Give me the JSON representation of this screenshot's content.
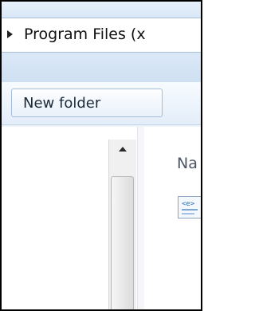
{
  "address_bar": {
    "expand_icon": "triangle-right-icon",
    "path_text": "Program Files (x"
  },
  "toolbar": {
    "new_folder_label": "New folder"
  },
  "navigation_pane": {
    "scroll_up_icon": "triangle-up-icon"
  },
  "content_pane": {
    "column_header": "Na",
    "file_icon": "html-file-icon",
    "file_icon_glyph": "<e>"
  },
  "colors": {
    "frame_blue": "#d9e7f7",
    "toolbar_bg": "#e3edf9",
    "border": "#000000"
  }
}
